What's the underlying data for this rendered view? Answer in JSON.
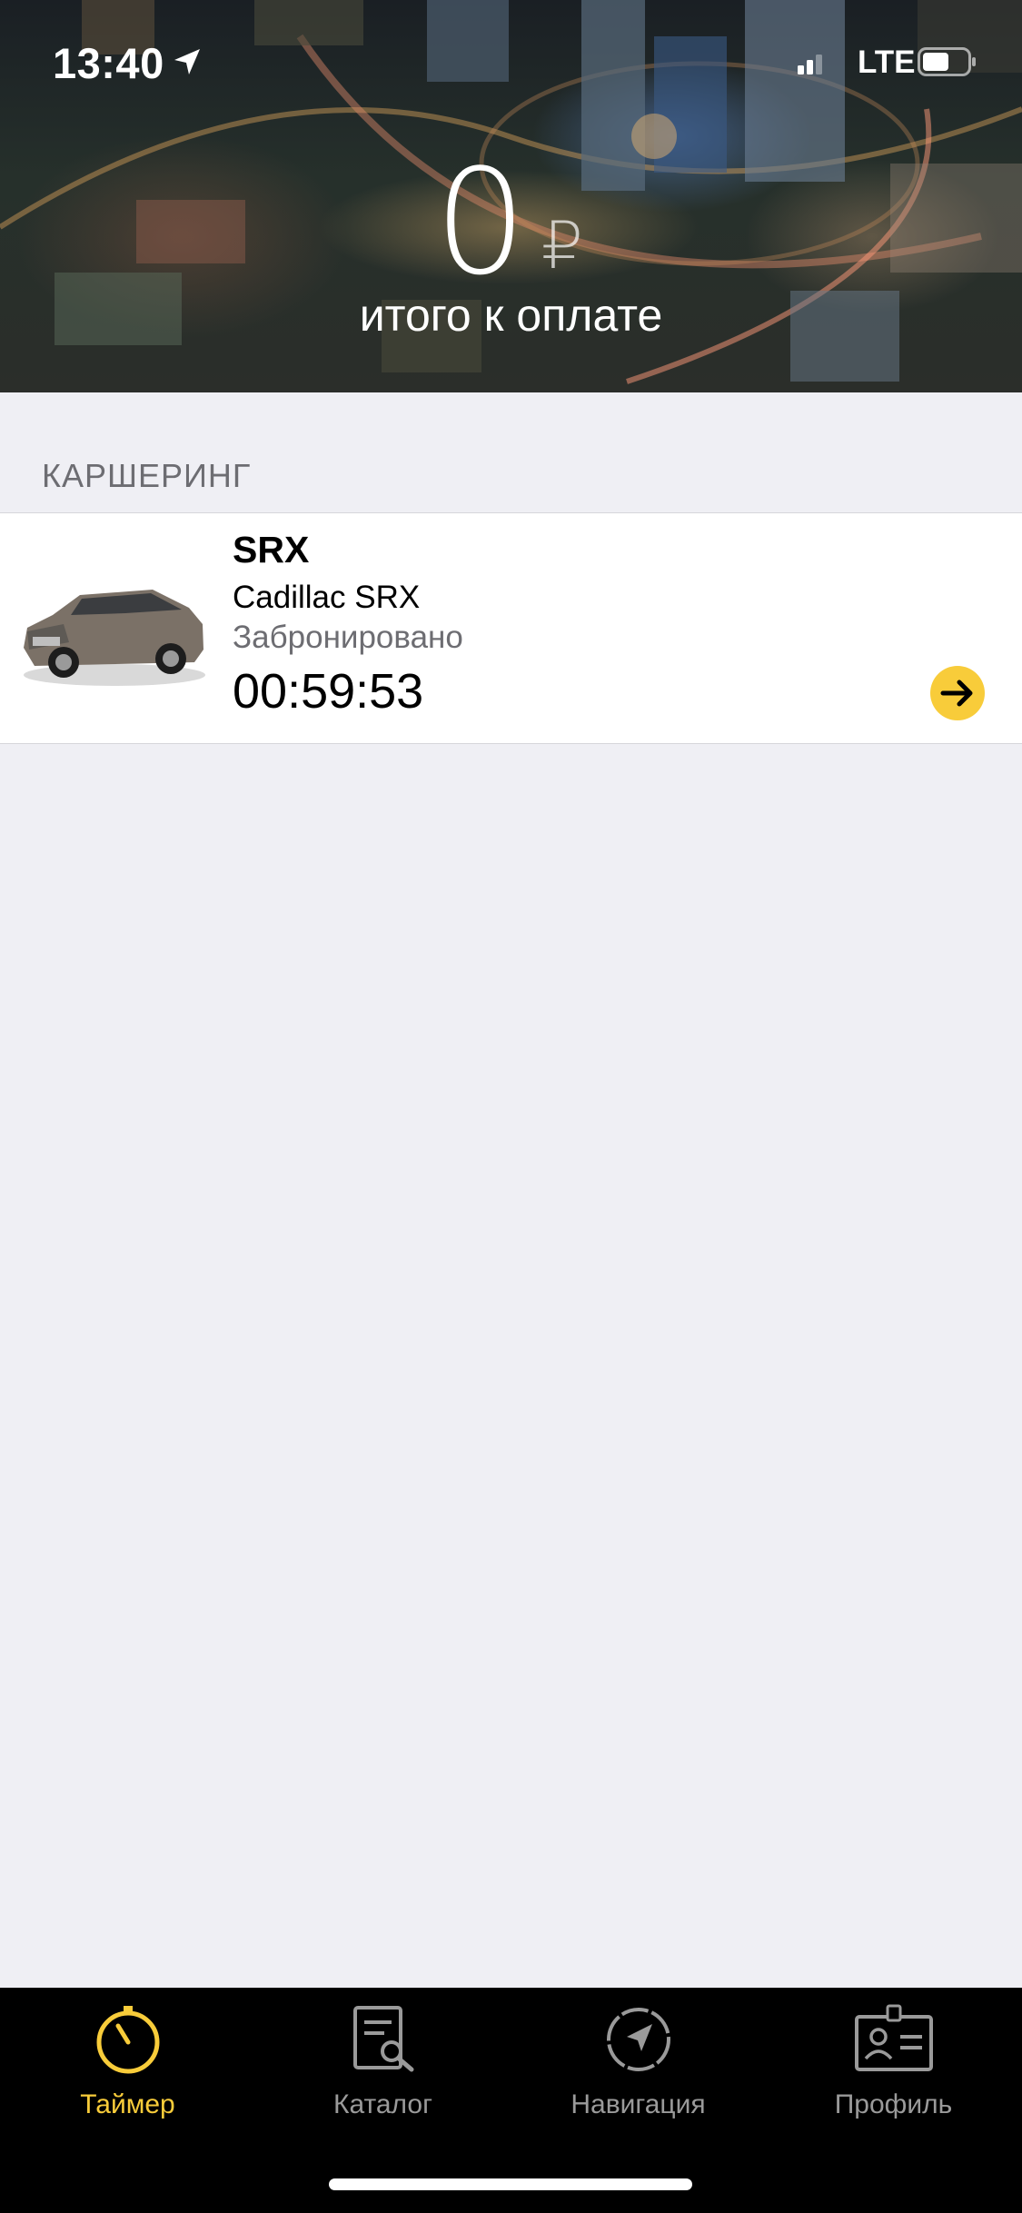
{
  "status_bar": {
    "time": "13:40",
    "network": "LTE",
    "icons": [
      "location-arrow-icon",
      "signal-icon",
      "battery-icon"
    ]
  },
  "summary": {
    "amount": "0",
    "currency": "₽",
    "label": "итого к оплате"
  },
  "section": {
    "header": "КАРШЕРИНГ"
  },
  "booking": {
    "name": "SRX",
    "model": "Cadillac SRX",
    "status": "Забронировано",
    "timer": "00:59:53",
    "action_icon": "arrow-right-icon"
  },
  "tabs": [
    {
      "label": "Таймер",
      "icon": "timer-icon",
      "active": true
    },
    {
      "label": "Каталог",
      "icon": "catalog-icon",
      "active": false
    },
    {
      "label": "Навигация",
      "icon": "navigation-icon",
      "active": false
    },
    {
      "label": "Профиль",
      "icon": "profile-icon",
      "active": false
    }
  ],
  "colors": {
    "accent": "#f8cc3a",
    "background": "#efeff4",
    "tab_inactive": "#9a9a9a",
    "secondary_text": "#6d6d72"
  }
}
